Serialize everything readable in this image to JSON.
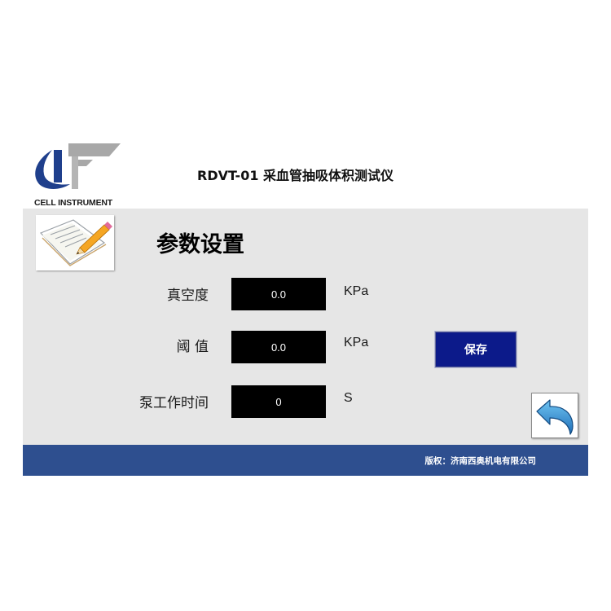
{
  "header": {
    "logo_text": "CELL INSTRUMENT",
    "title": "RDVT-01 采血管抽吸体积测试仪"
  },
  "main": {
    "section_title": "参数设置",
    "fields": [
      {
        "label": "真空度",
        "value": "0.0",
        "unit": "KPa"
      },
      {
        "label": "阈 值",
        "value": "0.0",
        "unit": "KPa"
      },
      {
        "label": "泵工作时间",
        "value": "0",
        "unit": "S"
      }
    ],
    "save_label": "保存"
  },
  "footer": {
    "copyright": "版权：济南西奥机电有限公司"
  },
  "colors": {
    "panel_bg": "#e6e6e6",
    "footer_bg": "#2e4f8f",
    "save_button_bg": "#0c1a8a",
    "field_bg": "#000000",
    "logo_blue": "#1f3f8c"
  },
  "icons": {
    "logo": "cell-instrument-logo-icon",
    "edit": "document-pencil-icon",
    "back": "back-arrow-icon"
  }
}
